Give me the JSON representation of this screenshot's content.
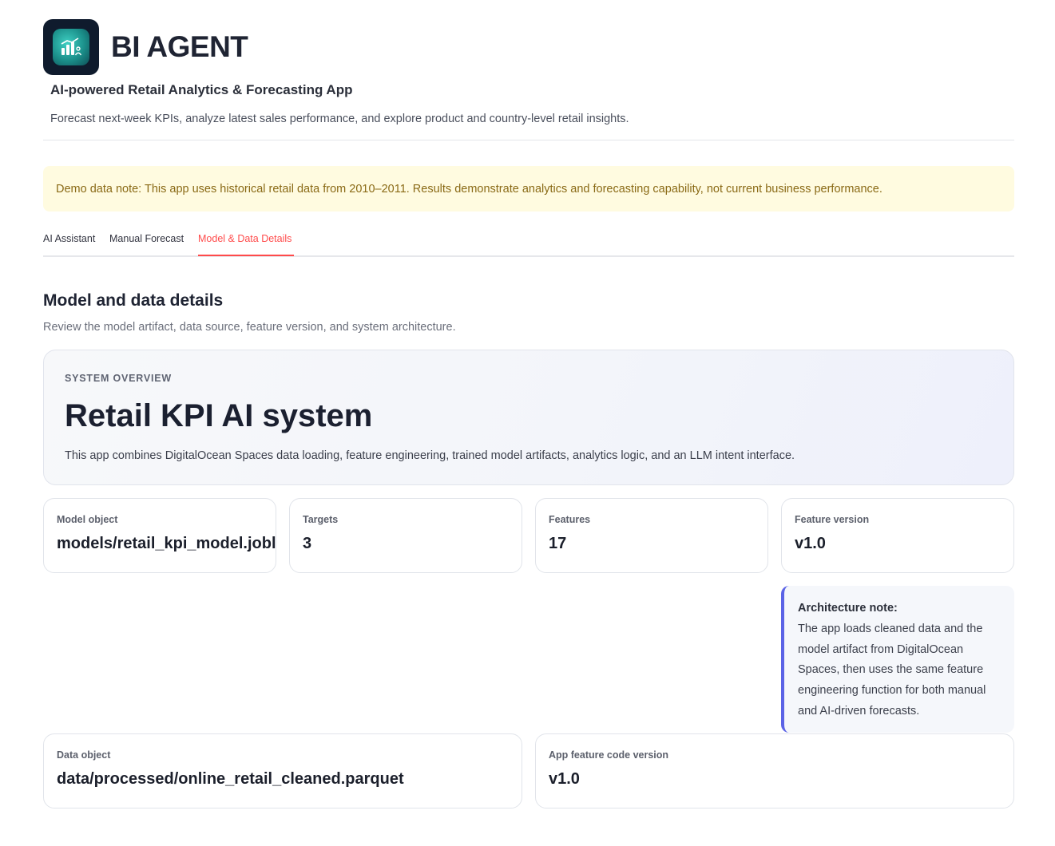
{
  "header": {
    "logo_icon": "bar-chart-ai-icon",
    "title": "BI AGENT",
    "subtitle": "AI-powered Retail Analytics & Forecasting App",
    "description": "Forecast next-week KPIs, analyze latest sales performance, and explore product and country-level retail insights."
  },
  "notice": {
    "text": "Demo data note: This app uses historical retail data from 2010–2011. Results demonstrate analytics and forecasting capability, not current business performance."
  },
  "tabs": [
    {
      "label": "AI Assistant",
      "active": false
    },
    {
      "label": "Manual Forecast",
      "active": false
    },
    {
      "label": "Model & Data Details",
      "active": true
    }
  ],
  "section": {
    "title": "Model and data details",
    "description": "Review the model artifact, data source, feature version, and system architecture."
  },
  "overview": {
    "label": "SYSTEM OVERVIEW",
    "title": "Retail KPI AI system",
    "description": "This app combines DigitalOcean Spaces data loading, feature engineering, trained model artifacts, analytics logic, and an LLM intent interface."
  },
  "metrics": [
    {
      "label": "Model object",
      "value": "models/retail_kpi_model.joblib"
    },
    {
      "label": "Targets",
      "value": "3"
    },
    {
      "label": "Features",
      "value": "17"
    },
    {
      "label": "Feature version",
      "value": "v1.0"
    }
  ],
  "architecture_note": {
    "title": "Architecture note:",
    "body": "The app loads cleaned data and the model artifact from DigitalOcean Spaces, then uses the same feature engineering function for both manual and AI-driven forecasts."
  },
  "details": [
    {
      "label": "Data object",
      "value": "data/processed/online_retail_cleaned.parquet"
    },
    {
      "label": "App feature code version",
      "value": "v1.0"
    }
  ],
  "colors": {
    "accent": "#ff4b4b",
    "note_border": "#5b63e6",
    "notice_bg": "#fffbe0",
    "notice_text": "#8a6a16"
  }
}
